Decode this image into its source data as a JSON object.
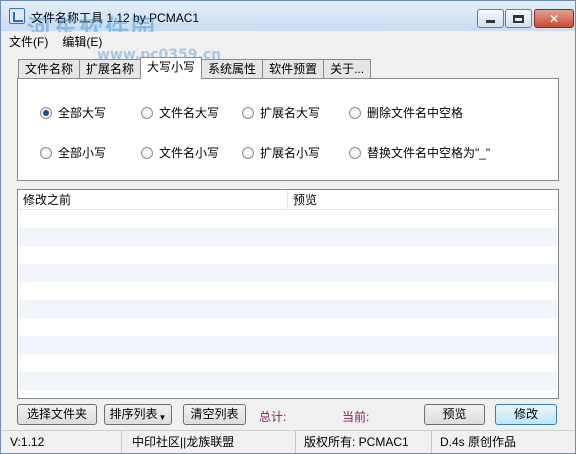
{
  "window": {
    "title": "文件名称工具 1.12  by PCMAC1",
    "watermark": "河东软件园",
    "watermark_url": "www.pc0359.cn",
    "close_glyph": "✕"
  },
  "menu": [
    "文件(F)",
    "编辑(E)"
  ],
  "tabs": [
    "文件名称",
    "扩展名称",
    "大写小写",
    "系统属性",
    "软件预置",
    "关于..."
  ],
  "active_tab": "大写小写",
  "options": [
    {
      "label": "全部大写",
      "checked": true
    },
    {
      "label": "文件名大写",
      "checked": false
    },
    {
      "label": "扩展名大写",
      "checked": false
    },
    {
      "label": "删除文件名中空格",
      "checked": false
    },
    {
      "label": "全部小写",
      "checked": false
    },
    {
      "label": "文件名小写",
      "checked": false
    },
    {
      "label": "扩展名小写",
      "checked": false
    },
    {
      "label": "替换文件名中空格为\"_\"",
      "checked": false
    }
  ],
  "list": {
    "columns": [
      "修改之前",
      "预览"
    ],
    "rows": []
  },
  "buttons": {
    "select_files": "选择文件夹",
    "sort_list": "排序列表",
    "clear_list": "清空列表",
    "preview": "预览",
    "modify": "修改"
  },
  "stats": {
    "total_label": "总计:",
    "current_label": "当前:"
  },
  "statusbar": {
    "version": "V:1.12",
    "community": "中印社区||龙族联盟",
    "copyright": "版权所有: PCMAC1",
    "original": "D.4s 原创作品"
  },
  "colors": {
    "stat_label": "#8b1c62",
    "list_alt_row": "#f1f5fb",
    "selected_radio": "#1d4e91"
  }
}
